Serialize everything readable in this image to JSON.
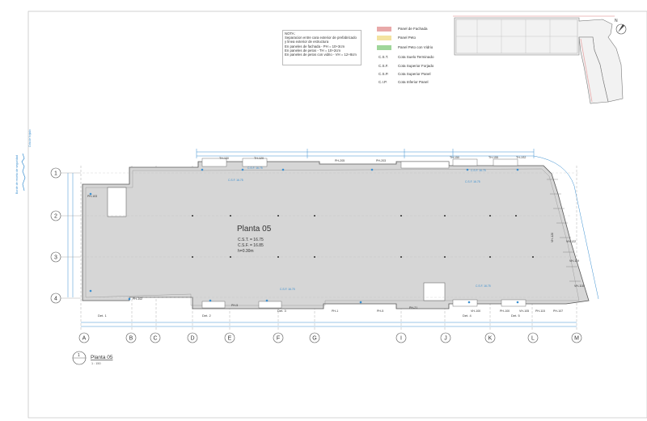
{
  "sheet": {
    "north_label": "N",
    "side_label_1": "Borde de recinto de seguridad",
    "side_label_2": "Cota de forjado"
  },
  "note": {
    "title": "NOTA:",
    "lines": [
      "Separacion entre cara exterior de prefabricado",
      "y linea exterior de estructura",
      "",
      "En paneles de fachada - PH = 10+3cm",
      "En paneles de petos - TH = 10+2cm",
      "En paneles de petos con vidrio - VH = 12+8cm"
    ]
  },
  "legend": {
    "items": [
      {
        "type": "swatch",
        "color": "#e8a9a9",
        "label": "Panel de Fachada"
      },
      {
        "type": "swatch",
        "color": "#f3e3a1",
        "label": "Panel Peto"
      },
      {
        "type": "swatch",
        "color": "#9fd69a",
        "label": "Panel Peto con Vidrio"
      },
      {
        "type": "code",
        "code": "C.S.T.",
        "label": "Cota Suelo Terminado"
      },
      {
        "type": "code",
        "code": "C.S.F.",
        "label": "Cota Superior Forjado"
      },
      {
        "type": "code",
        "code": "C.S.P.",
        "label": "Cota Superior Panel"
      },
      {
        "type": "code",
        "code": "C.I.P.",
        "label": "Cota Inferior Panel"
      }
    ]
  },
  "plan": {
    "title": "Planta 05",
    "cst": "C.S.T. = 16.75",
    "csf": "C.S.F. = 16.85",
    "h": "h=0.30m",
    "fill": "#d6d6d6",
    "stroke": "#555555",
    "accent": "#3a8fd0"
  },
  "grid": {
    "rows": [
      "1",
      "2",
      "3",
      "4"
    ],
    "columns": [
      "A",
      "B",
      "C",
      "D",
      "E",
      "F",
      "G",
      "I",
      "J",
      "K",
      "L",
      "M"
    ]
  },
  "panels_top": [
    "TH-130",
    "TH-120",
    "PH-205",
    "PH-203",
    "TH-150",
    "TH-155",
    "TH-1S2"
  ],
  "panels_bottom": [
    "PH-102",
    "PH-5",
    "PH-1",
    "PH-5",
    "PH-21",
    "VH-100",
    "PH-100",
    "VH-105",
    "PH-115",
    "PH-107"
  ],
  "panels_left": [
    "PH-103"
  ],
  "panels_right": [
    "VH-120",
    "VH-122",
    "VH-119",
    "VH-118"
  ],
  "details": [
    "Det. 1",
    "Det. 2",
    "Det. 3",
    "Det. 4",
    "Det. 5"
  ],
  "elevations": [
    "C.S.F. 16.75",
    "C.S.F. 16.75",
    "C.S.F. 16.75",
    "C.S.F. 16.75",
    "C.S.F. 16.75",
    "C.S.F. 16.75"
  ],
  "title_block": {
    "number": "1",
    "title": "Planta 05",
    "scale": "1 : 150"
  }
}
